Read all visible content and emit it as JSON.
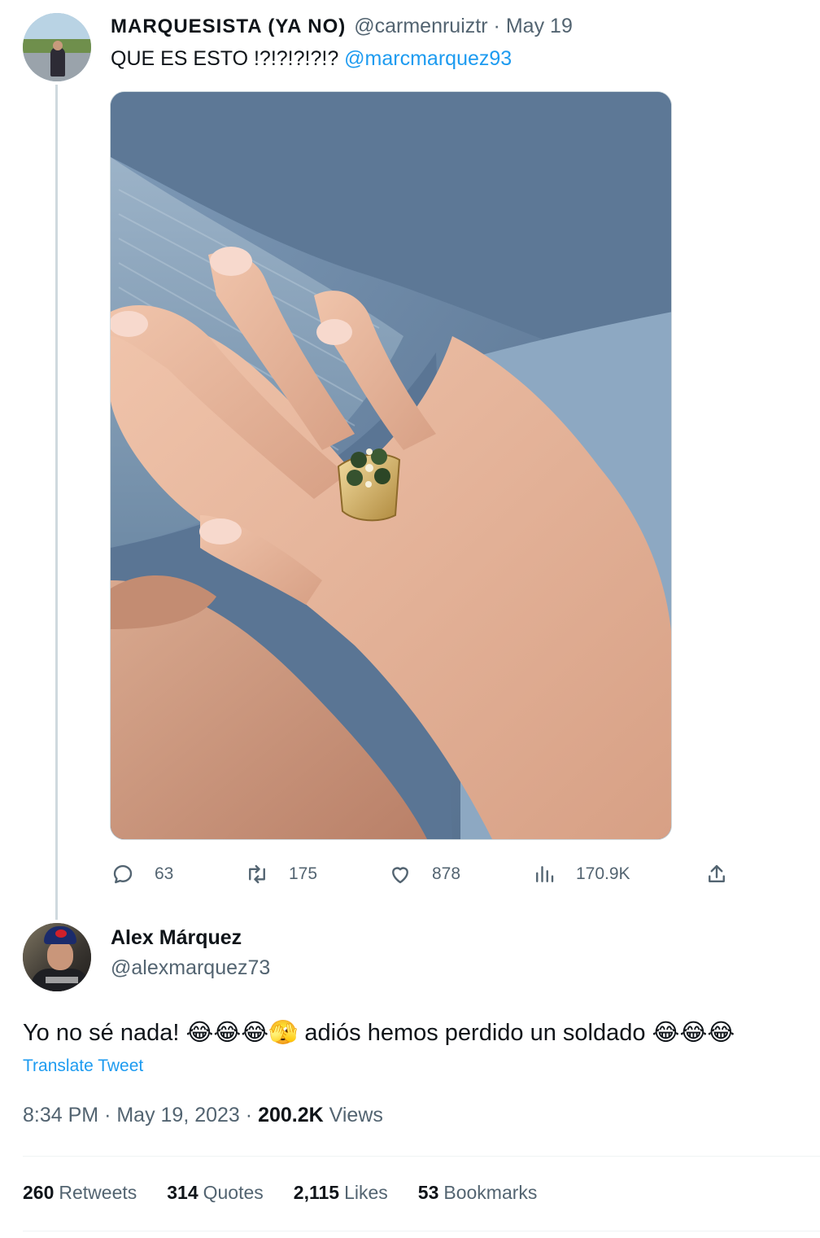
{
  "tweet1": {
    "name": "MARQUESISTA (YA NO)",
    "handle": "@carmenruiztr",
    "separator": "·",
    "date": "May 19",
    "text_prefix": "QUE ES ESTO !?!?!?!?!? ",
    "mention": "@marcmarquez93",
    "actions": {
      "reply": "63",
      "retweet": "175",
      "like": "878",
      "views": "170.9K"
    }
  },
  "tweet2": {
    "name": "Alex Márquez",
    "handle": "@alexmarquez73",
    "text": "Yo no sé nada! 😂😂😂🫣 adiós hemos perdido un soldado 😂😂😂",
    "translate": "Translate Tweet",
    "time": "8:34 PM",
    "meta_sep": "·",
    "date": "May 19, 2023",
    "views_count": "200.2K",
    "views_label": "Views",
    "stats": {
      "retweets_count": "260",
      "retweets_label": "Retweets",
      "quotes_count": "314",
      "quotes_label": "Quotes",
      "likes_count": "2,115",
      "likes_label": "Likes",
      "bookmarks_count": "53",
      "bookmarks_label": "Bookmarks"
    }
  },
  "colors": {
    "link": "#1d9bf0",
    "secondary_text": "#536471",
    "primary_text": "#0f1419",
    "thread_line": "#cfd9de"
  },
  "icons": [
    "reply-icon",
    "retweet-icon",
    "like-icon",
    "views-icon",
    "share-icon"
  ]
}
